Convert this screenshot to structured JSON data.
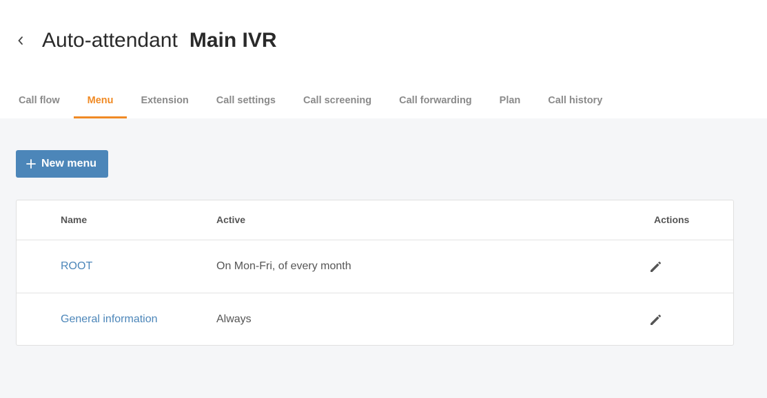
{
  "header": {
    "back_icon": "chevron-left-icon",
    "title_prefix": "Auto-attendant",
    "title_name": "Main IVR"
  },
  "tabs": [
    {
      "label": "Call flow",
      "active": false
    },
    {
      "label": "Menu",
      "active": true
    },
    {
      "label": "Extension",
      "active": false
    },
    {
      "label": "Call settings",
      "active": false
    },
    {
      "label": "Call screening",
      "active": false
    },
    {
      "label": "Call forwarding",
      "active": false
    },
    {
      "label": "Plan",
      "active": false
    },
    {
      "label": "Call history",
      "active": false
    }
  ],
  "toolbar": {
    "new_menu_label": "New menu",
    "new_menu_icon": "plus-icon"
  },
  "table": {
    "columns": {
      "name": "Name",
      "active": "Active",
      "actions": "Actions"
    },
    "rows": [
      {
        "name": "ROOT",
        "active": "On Mon-Fri, of every month",
        "action_icon": "pencil-edit-icon"
      },
      {
        "name": "General information",
        "active": "Always",
        "action_icon": "pencil-edit-icon"
      }
    ]
  },
  "colors": {
    "accent_orange": "#f08a24",
    "primary_blue": "#4c86b9",
    "background_grey": "#f5f6f8"
  }
}
